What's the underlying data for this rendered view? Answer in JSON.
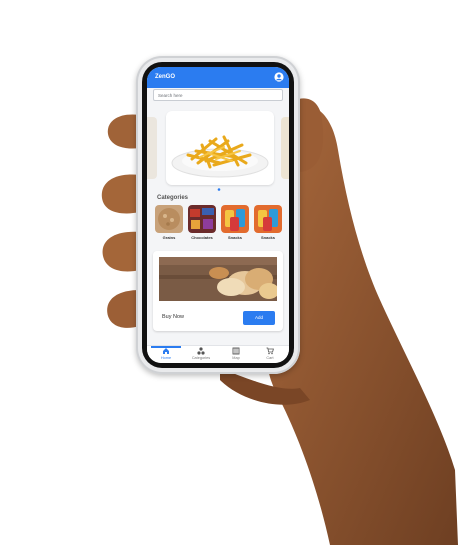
{
  "app": {
    "title": "ZenGO",
    "search_placeholder": "Search here",
    "accent_color": "#2b7cf0"
  },
  "carousel": {
    "current_slide": 1,
    "slide_count": 3,
    "main_image": "french-fries-plate"
  },
  "categories": {
    "title": "Categories",
    "items": [
      {
        "label": "Grains",
        "image": "grains-thumbnail"
      },
      {
        "label": "Chocolates",
        "image": "chocolates-thumbnail"
      },
      {
        "label": "Snacks",
        "image": "snacks-thumbnail"
      },
      {
        "label": "Snacks",
        "image": "snacks-thumbnail"
      }
    ]
  },
  "promo_card": {
    "image": "bread-loaves",
    "buy_label": "Buy Now",
    "add_label": "Add"
  },
  "bottom_nav": {
    "items": [
      {
        "label": "Home",
        "icon": "home-icon",
        "active": true
      },
      {
        "label": "Categories",
        "icon": "categories-icon",
        "active": false
      },
      {
        "label": "Map",
        "icon": "map-icon",
        "active": false
      },
      {
        "label": "Cart",
        "icon": "cart-icon",
        "active": false
      }
    ]
  }
}
